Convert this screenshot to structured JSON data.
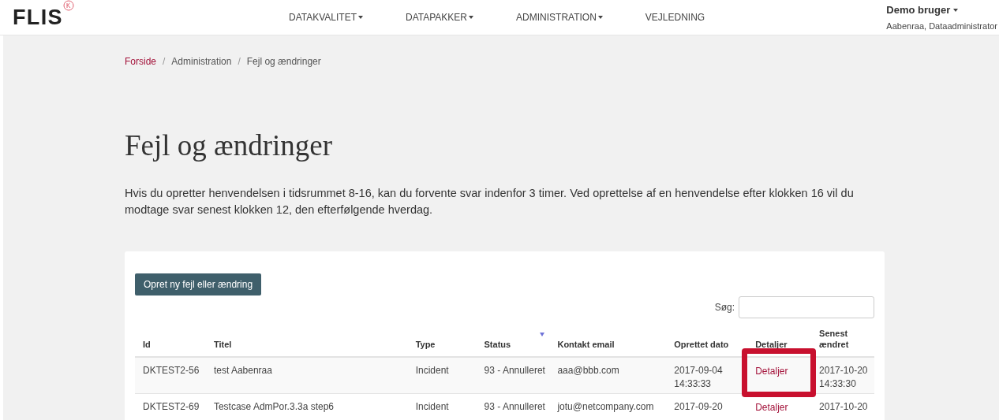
{
  "header": {
    "logo": "FLIS",
    "nav": [
      {
        "label": "DATAKVALITET",
        "dropdown": true
      },
      {
        "label": "DATAPAKKER",
        "dropdown": true
      },
      {
        "label": "ADMINISTRATION",
        "dropdown": true
      },
      {
        "label": "VEJLEDNING",
        "dropdown": false
      }
    ],
    "user": {
      "name": "Demo bruger",
      "role": "Aabenraa, Dataadministrator"
    }
  },
  "breadcrumb": [
    {
      "label": "Forside",
      "link": true
    },
    {
      "separator": "/",
      "label": "Administration",
      "link": false
    },
    {
      "separator": "/",
      "label": "Fejl og ændringer",
      "link": false
    }
  ],
  "title": "Fejl og ændringer",
  "intro": "Hvis du opretter henvendelsen i tidsrummet 8-16, kan du forvente svar indenfor 3 timer. Ved oprettelse af en henvendelse efter klokken 16 vil du modtage svar senest klokken 12, den efterfølgende hverdag.",
  "create_button": "Opret ny fejl eller ændring",
  "search": {
    "label": "Søg:"
  },
  "table": {
    "columns": [
      {
        "label": "Id",
        "sorted": false
      },
      {
        "label": "Titel",
        "sorted": false
      },
      {
        "label": "Type",
        "sorted": false
      },
      {
        "label": "Status",
        "sorted": true
      },
      {
        "label": "Kontakt email",
        "sorted": false
      },
      {
        "label": "Oprettet dato",
        "sorted": false
      },
      {
        "label": "Detaljer",
        "sorted": false
      },
      {
        "label": "Senest ændret",
        "sorted": false
      }
    ],
    "rows": [
      {
        "highlighted": true,
        "cells": [
          "DKTEST2-56",
          "test Aabenraa",
          "Incident",
          "93 - Annulleret",
          "aaa@bbb.com",
          "2017-09-04 14:33:33",
          "Detaljer",
          "2017-10-20 14:33:30"
        ]
      },
      {
        "highlighted": false,
        "cells": [
          "DKTEST2-69",
          "Testcase AdmPor.3.3a step6",
          "Incident",
          "93 - Annulleret",
          "jotu@netcompany.com",
          "2017-09-20",
          "Detaljer",
          "2017-10-20"
        ]
      }
    ]
  }
}
